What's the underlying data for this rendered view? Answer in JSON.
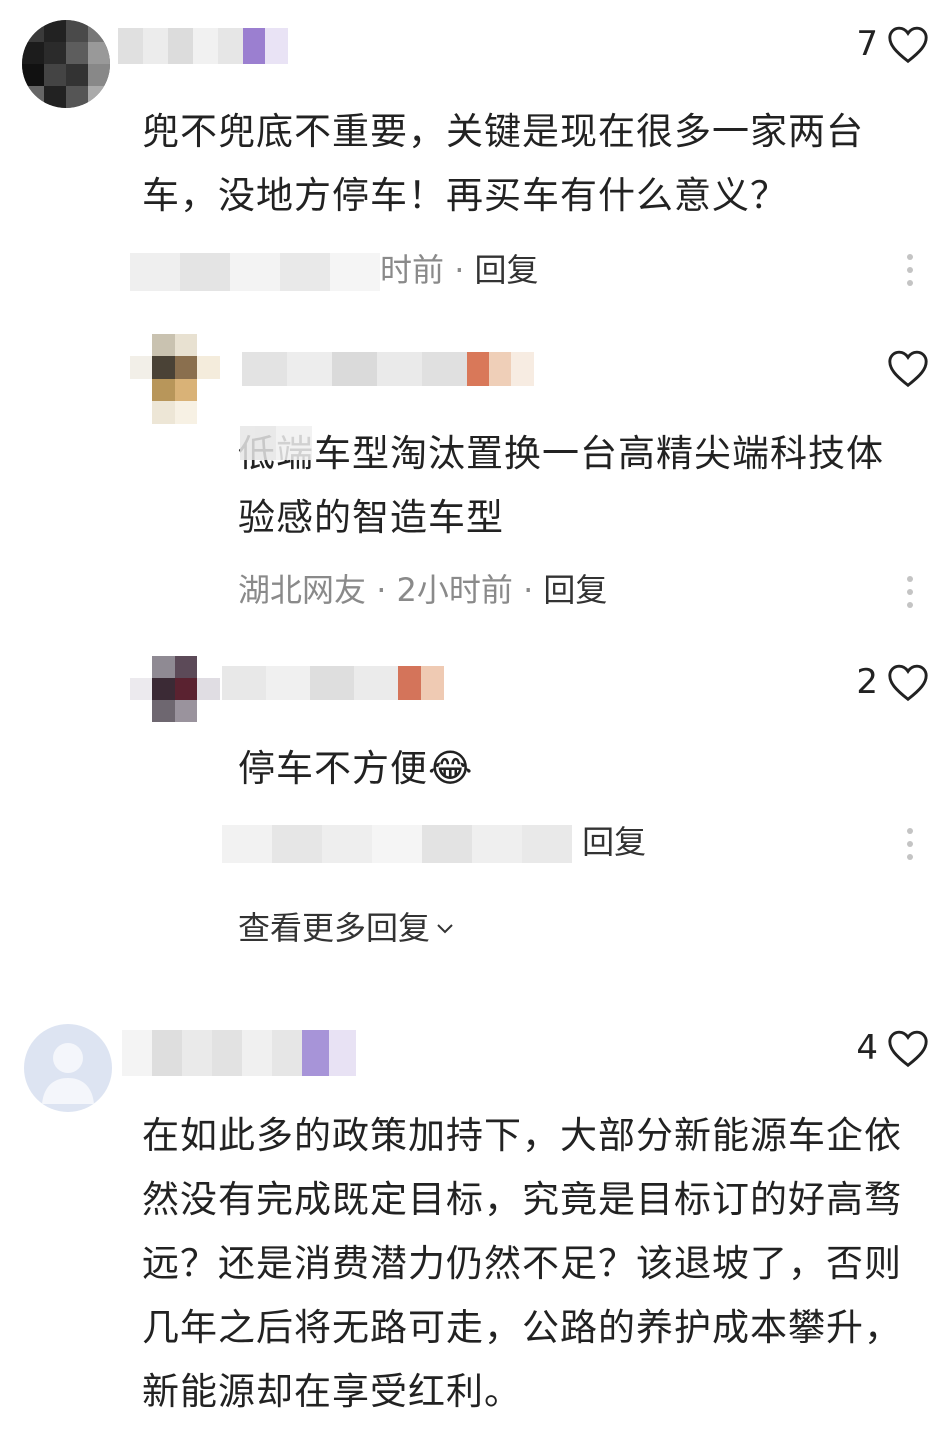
{
  "comments": [
    {
      "likes": "7",
      "text": "兜不兜底不重要，关键是现在很多一家两台车，没地方停车！再买车有什么意义？",
      "meta_visible": "时前",
      "reply_label": "回复",
      "replies": [
        {
          "likes": "",
          "text": "低端车型淘汰置换一台高精尖端科技体验感的智造车型",
          "location": "湖北网友",
          "time": "2小时前",
          "reply_label": "回复"
        },
        {
          "likes": "2",
          "text": "停车不方便",
          "emoji": "😂",
          "reply_label": "回复"
        }
      ],
      "view_more": "查看更多回复"
    },
    {
      "likes": "4",
      "text": "在如此多的政策加持下，大部分新能源车企依然没有完成既定目标，究竟是目标订的好高骛远？还是消费潜力仍然不足？该退坡了，否则几年之后将无路可走，公路的养护成本攀升，新能源却在享受红利。"
    }
  ],
  "separator": "·",
  "icons": {
    "like": "heart-outline-icon",
    "more": "vertical-dots-icon",
    "expand": "chevron-down-icon"
  },
  "colors": {
    "text": "#222222",
    "meta": "#8a8a8a",
    "icon": "#c4c4c4"
  }
}
